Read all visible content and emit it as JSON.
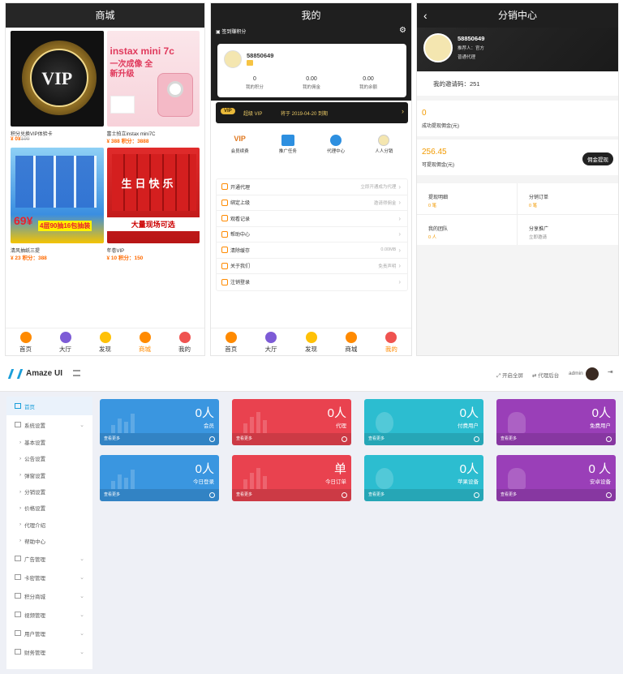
{
  "shop": {
    "title": "商城",
    "products": [
      {
        "name": "积分兑换VIP体验卡",
        "price": "¥ 0¥",
        "orig": "199",
        "img_text": "VIP",
        "theme": "vip"
      },
      {
        "name": "富士拍立instax mini7C",
        "price": "¥ 388 积分：3888",
        "orig": "",
        "img_text": "instax mini 7c",
        "img_sub": "一次成像 全新升级",
        "theme": "instax"
      },
      {
        "name": "清风抽纸三提",
        "price": "¥ 23 积分：388",
        "orig": "",
        "img_text": "69¥",
        "img_sub": "4层90抽16包抽装",
        "theme": "tissue"
      },
      {
        "name": "年卷VIP",
        "price": "¥ 10 积分：150",
        "orig": "",
        "img_text": "生日快乐",
        "img_sub": "大量现场可选",
        "theme": "cola"
      }
    ]
  },
  "tabs": [
    "首页",
    "大厅",
    "发现",
    "商城",
    "我的"
  ],
  "mine": {
    "title": "我的",
    "signin": "签到赚积分",
    "user_id": "58850649",
    "stats": [
      {
        "value": "0",
        "label": "我的积分"
      },
      {
        "value": "0.00",
        "label": "我的佣金"
      },
      {
        "value": "0.00",
        "label": "我的余额"
      }
    ],
    "vip_badge": "VIP",
    "vip_title": "超级 VIP",
    "vip_expire": "将于 2019-04-20 到期",
    "quick": [
      {
        "label": "会员续费",
        "icon": "vip-icon"
      },
      {
        "label": "推广任务",
        "icon": "gift-icon"
      },
      {
        "label": "代理中心",
        "icon": "agent-icon"
      },
      {
        "label": "人人分销",
        "icon": "share-icon"
      }
    ],
    "menu": [
      {
        "label": "开通代理",
        "value": "立即开通成为代理"
      },
      {
        "label": "绑定上级",
        "value": "邀请得佣金"
      },
      {
        "label": "观看记录",
        "value": ""
      },
      {
        "label": "帮助中心",
        "value": ""
      },
      {
        "label": "清除缓存",
        "value": "0.00MB"
      },
      {
        "label": "关于我们",
        "value": "免责声明"
      },
      {
        "label": "注销登录",
        "value": ""
      }
    ]
  },
  "dist": {
    "title": "分销中心",
    "back": "‹",
    "user_id": "58850649",
    "referrer": "推荐人：官方",
    "level": "普通代理",
    "invite": "我的邀请码：251",
    "withdrawn_value": "0",
    "withdrawn_label": "成功提现佣金(元)",
    "available_value": "256.45",
    "available_label": "可提现佣金(元)",
    "withdraw_button": "佣金提现",
    "cells": [
      {
        "label": "提现明细",
        "value": "0 笔"
      },
      {
        "label": "分销订单",
        "value": "0 笔"
      },
      {
        "label": "我的团队",
        "value": "0 人"
      },
      {
        "label": "分享推广",
        "value": "立即邀请"
      }
    ]
  },
  "admin": {
    "brand": "Amaze UI",
    "fullscreen": "开启全屏",
    "backend": "代理后台",
    "user": "admin",
    "sidebar": {
      "home": "首页",
      "system": "系统设置",
      "sub": [
        "基本设置",
        "公告设置",
        "弹窗设置",
        "分销设置",
        "价格设置",
        "代理介绍",
        "帮助中心"
      ],
      "groups": [
        "广告管理",
        "卡密管理",
        "积分商城",
        "视频管理",
        "用户管理",
        "财务管理"
      ]
    },
    "cards": [
      {
        "value": "0人",
        "label": "会员",
        "more": "查看更多",
        "color": "#3a96e0"
      },
      {
        "value": "0人",
        "label": "代理",
        "more": "查看更多",
        "color": "#e9424f"
      },
      {
        "value": "0人",
        "label": "付费用户",
        "more": "查看更多",
        "color": "#2cbdd0"
      },
      {
        "value": "0人",
        "label": "免费用户",
        "more": "查看更多",
        "color": "#9a3fb8"
      },
      {
        "value": "0人",
        "label": "今日登录",
        "more": "查看更多",
        "color": "#3a96e0"
      },
      {
        "value": "单",
        "label": "今日订单",
        "more": "查看更多",
        "color": "#e9424f"
      },
      {
        "value": "0人",
        "label": "苹果设备",
        "more": "查看更多",
        "color": "#2cbdd0"
      },
      {
        "value": "0 人",
        "label": "安卓设备",
        "more": "查看更多",
        "color": "#9a3fb8"
      }
    ]
  }
}
